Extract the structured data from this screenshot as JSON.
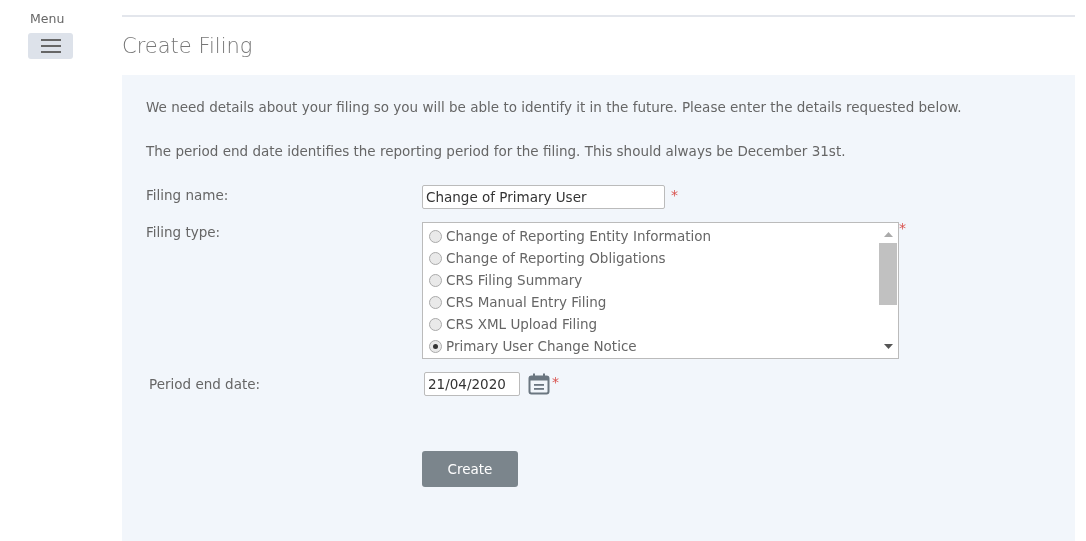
{
  "sidebar": {
    "menu_label": "Menu"
  },
  "page": {
    "title": "Create Filing"
  },
  "intro": [
    "We need details about your filing so you will be able to identify it in the future. Please enter the details requested below.",
    "The period end date identifies the reporting period for the filing. This should always be December 31st."
  ],
  "filing_name": {
    "label": "Filing name:",
    "value": "Change of Primary User",
    "required_mark": "*"
  },
  "filing_type": {
    "label": "Filing type:",
    "required_mark": "*",
    "options": [
      {
        "label": "Change of Reporting Entity Information",
        "selected": false
      },
      {
        "label": "Change of Reporting Obligations",
        "selected": false
      },
      {
        "label": "CRS Filing Summary",
        "selected": false
      },
      {
        "label": "CRS Manual Entry Filing",
        "selected": false
      },
      {
        "label": "CRS XML Upload Filing",
        "selected": false
      },
      {
        "label": "Primary User Change Notice",
        "selected": true
      }
    ]
  },
  "period_end_date": {
    "label": "Period end date:",
    "value": "21/04/2020",
    "required_mark": "*"
  },
  "buttons": [
    "Create"
  ]
}
